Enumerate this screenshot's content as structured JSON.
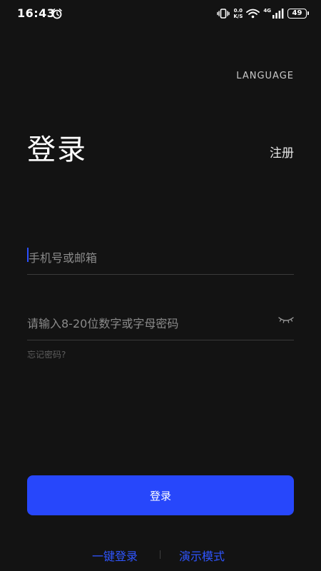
{
  "status_bar": {
    "time": "16:43",
    "net_speed_top": "0.0",
    "net_speed_bottom": "K/S",
    "network_type": "4G",
    "battery": "49",
    "icons": [
      "alarm-icon",
      "vibrate-icon",
      "wifi-icon",
      "signal-icon",
      "battery-icon"
    ]
  },
  "header": {
    "language_label": "LANGUAGE"
  },
  "title": {
    "text": "登录",
    "register_label": "注册"
  },
  "form": {
    "account_placeholder": "手机号或邮箱",
    "account_value": "",
    "password_placeholder": "请输入8-20位数字或字母密码",
    "password_value": "",
    "forgot_label": "忘记密码?",
    "password_toggle_icon": "eye-closed-icon"
  },
  "actions": {
    "login_label": "登录",
    "one_click_login_label": "一键登录",
    "demo_mode_label": "演示模式"
  },
  "colors": {
    "background": "#131313",
    "accent": "#2747fb",
    "link": "#2f55ff"
  }
}
